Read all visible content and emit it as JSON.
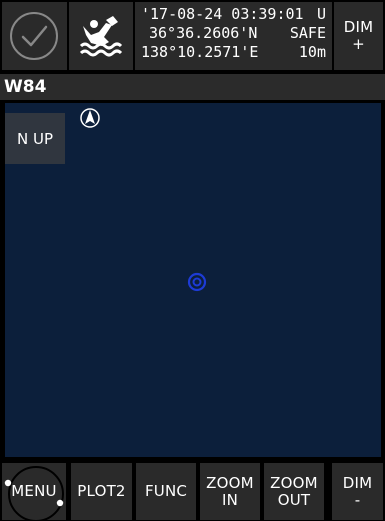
{
  "status": {
    "datetime": "'17-08-24 03:39:01",
    "utc_flag": "U",
    "latitude": "36°36.2606'N",
    "safety": "SAFE",
    "longitude": "138°10.2571'E",
    "accuracy": "10m"
  },
  "top_buttons": {
    "dim_plus_line1": "DIM",
    "dim_plus_line2": "+"
  },
  "station": {
    "label": "W84"
  },
  "map": {
    "orientation_label": "N UP",
    "background_color": "#0c1f3b",
    "position_marker_color": "#1d3bd6"
  },
  "bottom_buttons": {
    "menu": "MENU",
    "plot2": "PLOT2",
    "func": "FUNC",
    "zoom_in_line1": "ZOOM",
    "zoom_in_line2": "IN",
    "zoom_out_line1": "ZOOM",
    "zoom_out_line2": "OUT",
    "dim_minus_line1": "DIM",
    "dim_minus_line2": "-"
  }
}
